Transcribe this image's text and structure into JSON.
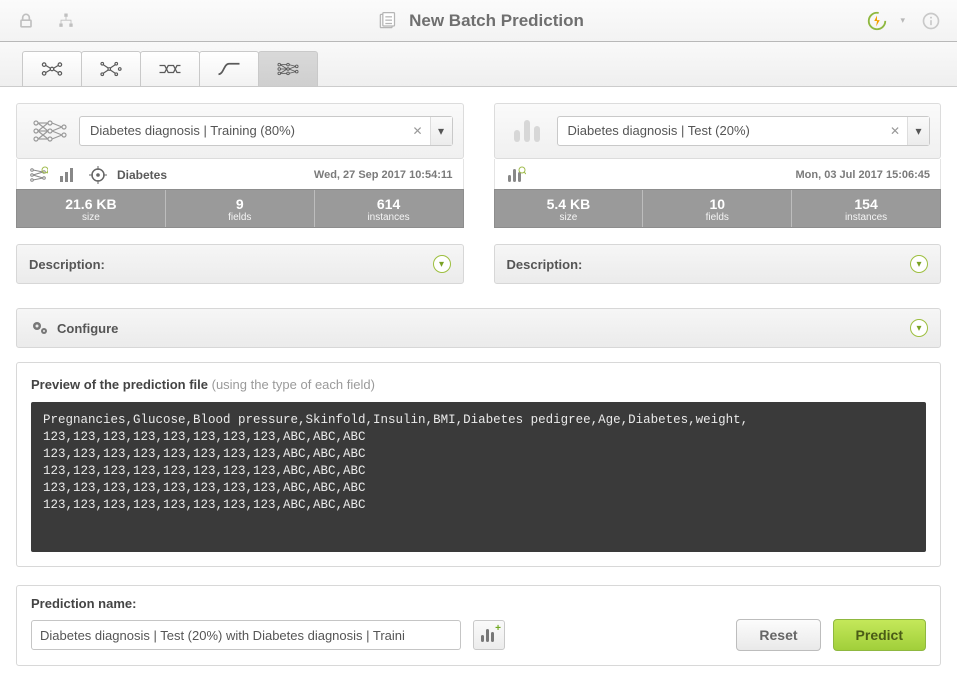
{
  "header": {
    "title": "New Batch Prediction"
  },
  "model": {
    "selected": "Diabetes diagnosis | Training (80%)",
    "objective": "Diabetes",
    "timestamp": "Wed, 27 Sep 2017 10:54:11",
    "size_val": "21.6 KB",
    "size_lbl": "size",
    "fields_val": "9",
    "fields_lbl": "fields",
    "instances_val": "614",
    "instances_lbl": "instances",
    "description_label": "Description:"
  },
  "dataset": {
    "selected": "Diabetes diagnosis | Test (20%)",
    "timestamp": "Mon, 03 Jul 2017 15:06:45",
    "size_val": "5.4 KB",
    "size_lbl": "size",
    "fields_val": "10",
    "fields_lbl": "fields",
    "instances_val": "154",
    "instances_lbl": "instances",
    "description_label": "Description:"
  },
  "configure": {
    "label": "Configure"
  },
  "preview": {
    "title": "Preview of the prediction file",
    "subtitle": "(using the type of each field)",
    "content": "Pregnancies,Glucose,Blood pressure,Skinfold,Insulin,BMI,Diabetes pedigree,Age,Diabetes,weight,\n123,123,123,123,123,123,123,123,ABC,ABC,ABC\n123,123,123,123,123,123,123,123,ABC,ABC,ABC\n123,123,123,123,123,123,123,123,ABC,ABC,ABC\n123,123,123,123,123,123,123,123,ABC,ABC,ABC\n123,123,123,123,123,123,123,123,ABC,ABC,ABC"
  },
  "prediction": {
    "label": "Prediction name:",
    "value": "Diabetes diagnosis | Test (20%) with Diabetes diagnosis | Traini"
  },
  "buttons": {
    "reset": "Reset",
    "predict": "Predict"
  }
}
